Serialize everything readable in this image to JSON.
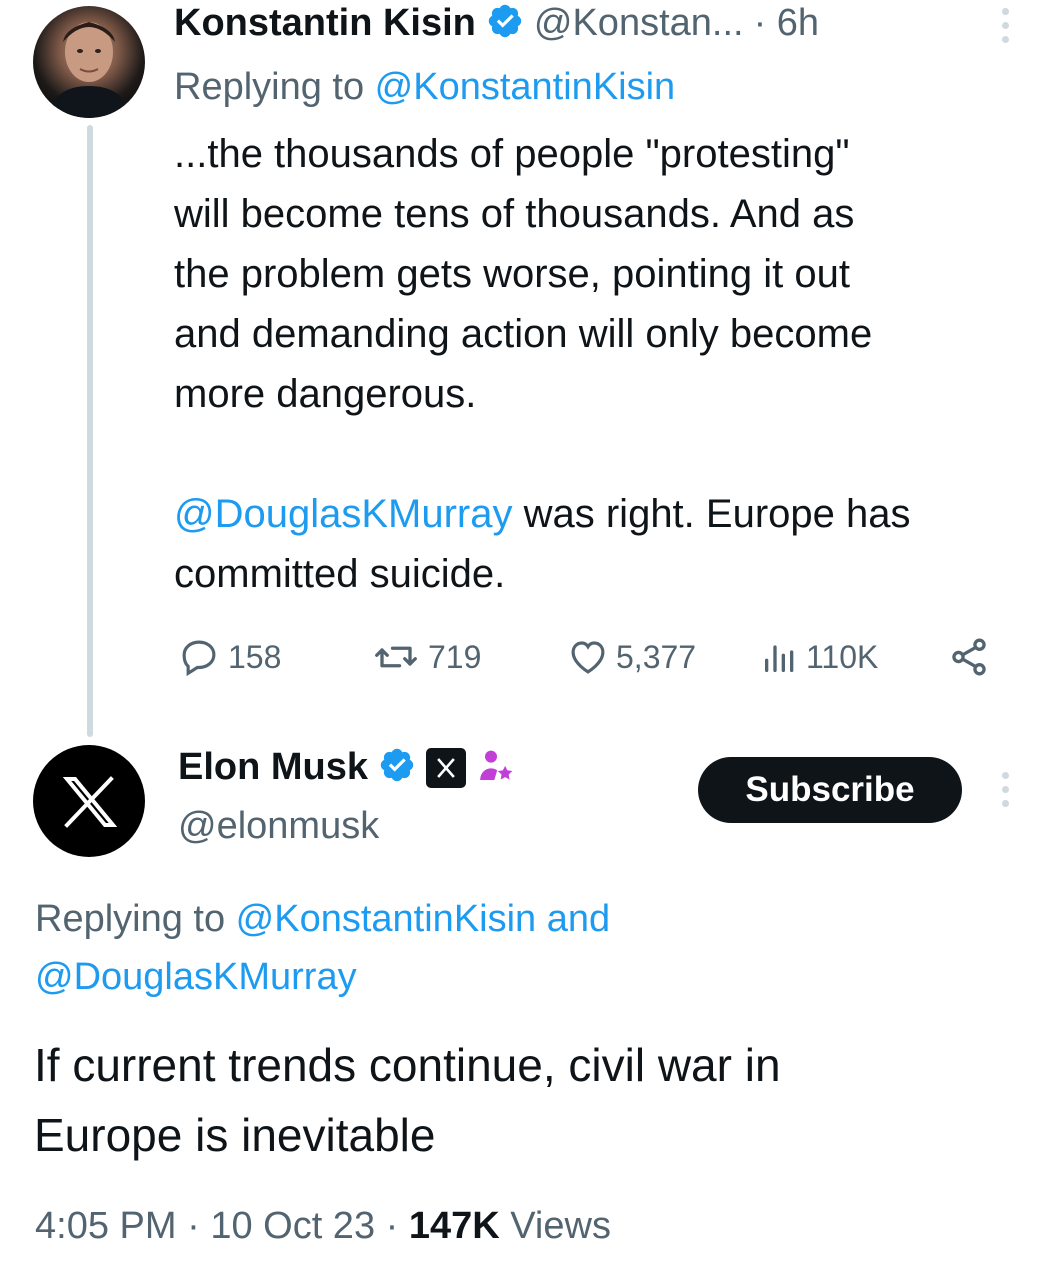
{
  "tweet1": {
    "name": "Konstantin Kisin",
    "handle": "@Konstan...",
    "time": "· 6h",
    "replying_prefix": "Replying to ",
    "replying_handle": "@KonstantinKisin",
    "lines": [
      "...the thousands of people \"protesting\"",
      "will become tens of thousands. And as",
      "the problem gets worse, pointing it out",
      "and demanding action will only become",
      "more dangerous."
    ],
    "mention": "@DouglasKMurray",
    "line6_rest": " was right. Europe has",
    "line7": "committed suicide.",
    "stats": {
      "replies": "158",
      "reposts": "719",
      "likes": "5,377",
      "views": "110K"
    },
    "icons": [
      "reply-icon",
      "repost-icon",
      "like-icon",
      "views-icon",
      "share-icon",
      "more-icon",
      "verified-icon"
    ]
  },
  "tweet2": {
    "name": "Elon Musk",
    "handle": "@elonmusk",
    "subscribe_label": "Subscribe",
    "replying_prefix": "Replying to ",
    "replying_to_1": "@KonstantinKisin and",
    "replying_to_2": "@DouglasKMurray",
    "text_line1": "If current trends continue, civil war in",
    "text_line2": "Europe is inevitable",
    "time": "4:05 PM",
    "date": "10 Oct 23",
    "views_count": "147K",
    "views_label": "Views",
    "separator": "·",
    "icons": [
      "x-logo-icon",
      "verified-icon",
      "x-affiliate-badge-icon",
      "team-star-icon",
      "more-icon"
    ]
  },
  "colors": {
    "link": "#1d9bf0",
    "secondary_text": "#536471",
    "primary_text": "#0f1419",
    "thread_line": "#cfd9de",
    "verified_blue": "#1d9bf0",
    "badge_purple": "#c13fd6"
  }
}
